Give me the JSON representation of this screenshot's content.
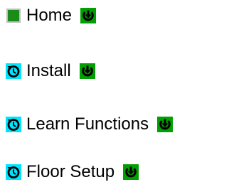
{
  "colors": {
    "done": "#1a8c1a",
    "done_border": "#bfbfbf",
    "pending_bg": "#00e5ff",
    "expand_bg": "#00a000",
    "icon_dark": "#000000"
  },
  "nav": {
    "items": [
      {
        "label": "Home",
        "status_icon": "completed-square-icon",
        "expand_icon": "expand-down-icon"
      },
      {
        "label": "Install",
        "status_icon": "in-progress-icon",
        "expand_icon": "expand-down-icon"
      },
      {
        "label": "Learn Functions",
        "status_icon": "in-progress-icon",
        "expand_icon": "expand-down-icon"
      },
      {
        "label": "Floor Setup",
        "status_icon": "in-progress-icon",
        "expand_icon": "expand-down-icon"
      }
    ]
  }
}
